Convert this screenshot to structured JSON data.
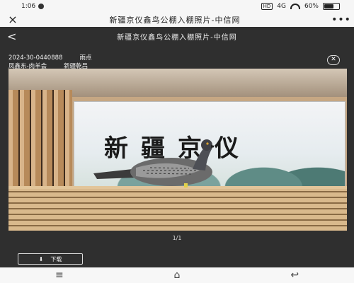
{
  "status": {
    "time": "1:06",
    "hd": "HD",
    "signal": "4G",
    "battery": "60%"
  },
  "header": {
    "close_icon": "×",
    "title": "新疆京仪鑫鸟公棚入棚照片-中信网",
    "more_icon": "•••"
  },
  "viewer": {
    "back_icon": "<",
    "title": "新疆京仪鑫鸟公棚入棚照片-中信网",
    "ring_no": "2024-30-0440888",
    "color": "雨点",
    "owner": "凤鑫东-肉羊会",
    "region": "新疆乾昌",
    "close_icon": "✕",
    "page_indicator": "1/1",
    "download_icon": "⬇",
    "download_label": "下载"
  },
  "photo": {
    "banner_text": "新疆京仪"
  },
  "navbar": {
    "menu_icon": "≡",
    "home_icon": "⌂",
    "back_icon": "↩"
  }
}
